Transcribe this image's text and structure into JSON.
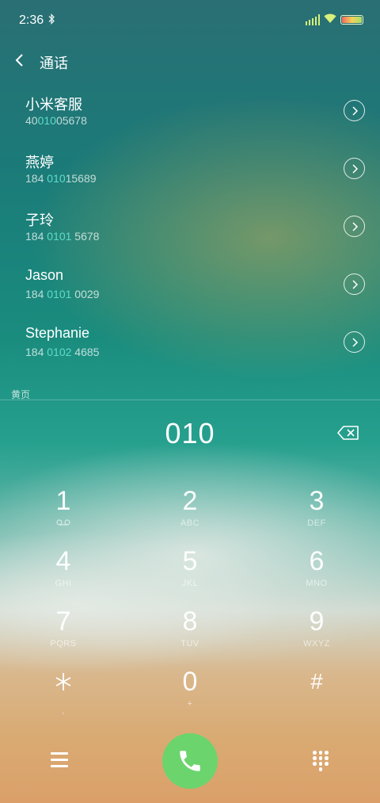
{
  "status_bar": {
    "time": "2:36",
    "bluetooth_icon": "bluetooth-icon",
    "signal_icon": "signal-icon",
    "wifi_icon": "wifi-icon",
    "battery_icon": "battery-icon",
    "battery_level": 1.0
  },
  "header": {
    "back_icon": "chevron-left-icon",
    "title": "通话"
  },
  "contacts": [
    {
      "name": "小米客服",
      "number_pre": "40",
      "number_match": "010",
      "number_post": "05678"
    },
    {
      "name": "燕婷",
      "number_pre": "184 ",
      "number_match": "010",
      "number_post": "15689"
    },
    {
      "name": "子玲",
      "number_pre": "184 ",
      "number_match": "0101",
      "number_post": " 5678"
    },
    {
      "name": "Jason",
      "number_pre": "184 ",
      "number_match": "0101",
      "number_post": " 0029"
    },
    {
      "name": "Stephanie",
      "number_pre": "184 ",
      "number_match": "0102",
      "number_post": " 4685"
    }
  ],
  "section_label": "黄页",
  "dialer": {
    "number": "010",
    "backspace_icon": "backspace-icon"
  },
  "keypad": [
    {
      "digit": "1",
      "letters": "voicemail-icon"
    },
    {
      "digit": "2",
      "letters": "ABC"
    },
    {
      "digit": "3",
      "letters": "DEF"
    },
    {
      "digit": "4",
      "letters": "GHI"
    },
    {
      "digit": "5",
      "letters": "JKL"
    },
    {
      "digit": "6",
      "letters": "MNO"
    },
    {
      "digit": "7",
      "letters": "PQRS"
    },
    {
      "digit": "8",
      "letters": "TUV"
    },
    {
      "digit": "9",
      "letters": "WXYZ"
    },
    {
      "digit": "*",
      "letters": ","
    },
    {
      "digit": "0",
      "letters": "+"
    },
    {
      "digit": "#",
      "letters": ""
    }
  ],
  "bottom_bar": {
    "menu_icon": "menu-icon",
    "call_icon": "phone-icon",
    "dialpad_icon": "dialpad-icon",
    "call_color": "#6cd46d"
  },
  "colors": {
    "match_highlight": "#5fdcc8"
  }
}
